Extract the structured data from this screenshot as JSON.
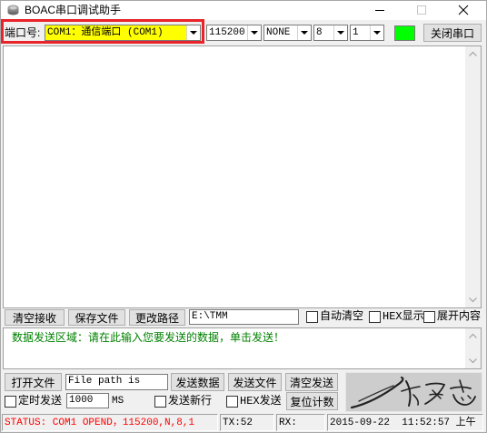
{
  "window": {
    "title": "BOAC串口调试助手"
  },
  "toolbar": {
    "port_label": "端口号:",
    "port_value": "COM1：通信端口 (COM1)",
    "baud_rate": "115200",
    "parity": "NONE",
    "data_bits": "8",
    "stop_bits": "1",
    "close_port_button": "关闭串口"
  },
  "receive_panel": {
    "clear_button": "清空接收",
    "save_button": "保存文件",
    "change_path_button": "更改路径",
    "save_path": "E:\\TMM",
    "auto_clear_checkbox": {
      "label": "自动清空",
      "checked": false
    },
    "hex_display_checkbox": {
      "label": "HEX显示",
      "checked": false
    },
    "expand_checkbox": {
      "label": "展开内容",
      "checked": false
    }
  },
  "send_panel": {
    "hint_text": "数据发送区域：请在此输入您要发送的数据，单击发送！",
    "open_file_button": "打开文件",
    "file_path": "File path is",
    "send_data_button": "发送数据",
    "send_file_button": "发送文件",
    "clear_send_button": "清空发送",
    "timed_send_checkbox": {
      "label": "定时发送",
      "checked": false
    },
    "interval": "1000",
    "interval_unit": "MS",
    "send_newline_checkbox": {
      "label": "发送新行",
      "checked": false
    },
    "hex_send_checkbox": {
      "label": "HEX发送",
      "checked": false
    },
    "reset_count_button": "复位计数"
  },
  "status_bar": {
    "status": "STATUS: COM1 OPEND，115200,N,8,1",
    "tx": "TX:52",
    "rx": "RX:",
    "datetime": "2015-09-22  11:52:57 上午"
  },
  "colors": {
    "port_select_bg": "#ffff00",
    "port_open_indicator": "#00ff00",
    "status_text": "#ff0000",
    "send_hint_text": "#008000",
    "highlight_box": "#e8242a"
  },
  "icons": {
    "app": "app-icon",
    "minimize": "minimize-icon",
    "maximize": "maximize-icon",
    "close": "close-icon",
    "dropdown": "chevron-down-icon",
    "scroll_up": "scroll-up-icon",
    "scroll_down": "scroll-down-icon"
  }
}
